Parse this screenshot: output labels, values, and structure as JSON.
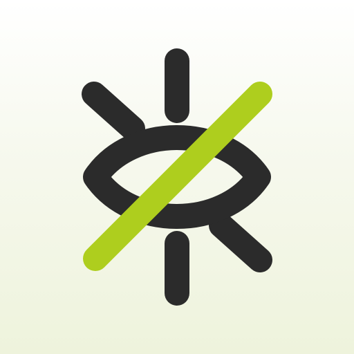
{
  "app_icon": {
    "icon_name": "eye-slash-icon",
    "colors": {
      "background_top": "#ffffff",
      "background_bottom": "#eef3dc",
      "eye_stroke": "#2b2b2b",
      "slash": "#aece1e"
    }
  }
}
